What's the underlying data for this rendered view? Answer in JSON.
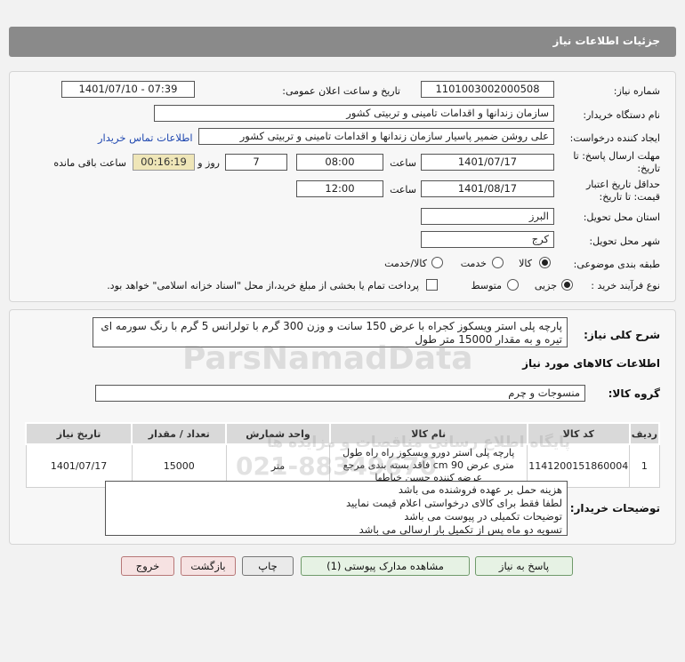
{
  "header": {
    "title": "جزئیات اطلاعات نیاز"
  },
  "info": {
    "need_number_label": "شماره نیاز:",
    "need_number": "1101003002000508",
    "announce_label": "تاریخ و ساعت اعلان عمومی:",
    "announce_value": "1401/07/10 - 07:39",
    "buyer_org_label": "نام دستگاه خریدار:",
    "buyer_org": "سازمان زندانها و اقدامات تامینی و تربیتی کشور",
    "creator_label": "ایجاد کننده درخواست:",
    "creator": "علی روشن ضمیر پاسیار سازمان زندانها و اقدامات تامینی و تربیتی کشور",
    "contact_link": "اطلاعات تماس خریدار",
    "deadline_label_1": "مهلت ارسال پاسخ: تا",
    "deadline_label_2": "تاریخ:",
    "deadline_date": "1401/07/17",
    "hour_label": "ساعت",
    "deadline_time": "08:00",
    "days_value": "7",
    "days_label": "روز و",
    "remaining_time": "00:16:19",
    "remaining_label": "ساعت باقی مانده",
    "validity_label_1": "حداقل تاریخ اعتبار",
    "validity_label_2": "قیمت: تا تاریخ:",
    "validity_date": "1401/08/17",
    "validity_time": "12:00",
    "province_label": "استان محل تحویل:",
    "province": "البرز",
    "city_label": "شهر محل تحویل:",
    "city": "کرج",
    "category_label": "طبقه بندی موضوعی:",
    "category_options": [
      "کالا",
      "خدمت",
      "کالا/خدمت"
    ],
    "process_label": "نوع فرآیند خرید :",
    "process_options": [
      "جزیی",
      "متوسط"
    ],
    "payment_note": "پرداخت تمام یا بخشی از مبلغ خرید،از محل \"اسناد خزانه اسلامی\" خواهد بود."
  },
  "description": {
    "label": "شرح کلی نیاز:",
    "text": "پارچه پلی استر ویسکوز کجراه با عرض 150 سانت و وزن 300 گرم با تولرانس 5 گرم با رنگ سورمه ای تیره و به مقدار 15000 متر طول"
  },
  "goods": {
    "section_title": "اطلاعات کالاهای مورد نیاز",
    "group_label": "گروه کالا:",
    "group_value": "منسوجات و چرم",
    "columns": [
      "ردیف",
      "کد کالا",
      "نام کالا",
      "واحد شمارش",
      "تعداد / مقدار",
      "تاریخ نیاز"
    ],
    "rows": [
      {
        "index": "1",
        "code": "1141200151860004",
        "name": "پارچه پلی استر دورو ویسکوز راه راه طول متری عرض 90 cm فاقد بسته بندی مرجع عرضه کننده حسین خیاطها",
        "unit": "متر",
        "qty": "15000",
        "date": "1401/07/17"
      }
    ]
  },
  "buyer_notes": {
    "label": "توضیحات خریدار:",
    "lines": [
      "هزینه حمل بر عهده فروشنده می باشد",
      "لطفا فقط برای کالای درخواستی اعلام قیمت نمایید",
      "توضیحات تکمیلی در پیوست می باشد",
      "تسویه دو ماه پس از تکمیل بار ارسالی می باشد"
    ]
  },
  "buttons": {
    "reply": "پاسخ به نیاز",
    "attachments": "مشاهده مدارک پیوستی (1)",
    "print": "چاپ",
    "back": "بازگشت",
    "exit": "خروج"
  },
  "watermark": {
    "brand": "ParsNamadData",
    "slogan": "پایگاه اطلاع رسانی مناقصات و مزایده ها",
    "phone": "021-88349670"
  }
}
